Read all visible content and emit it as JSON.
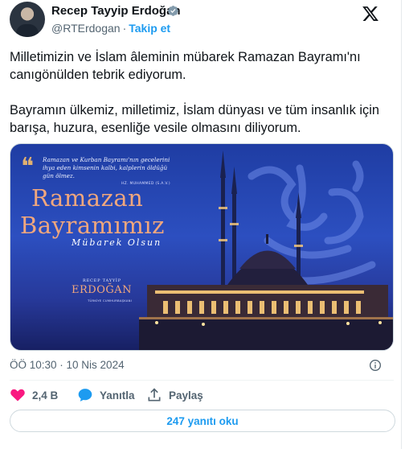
{
  "author": {
    "name": "Recep Tayyip Erdoğan",
    "handle": "@RTErdogan",
    "separator": "·",
    "follow_label": "Takip et"
  },
  "icons": {
    "verified": "verified-badge-icon",
    "x_logo": "x-logo-icon",
    "info": "info-icon",
    "like": "heart-icon",
    "reply": "speech-bubble-icon",
    "share": "share-icon"
  },
  "tweet": {
    "paragraphs": [
      "Milletimizin ve İslam âleminin mübarek Ramazan Bayramı'nı canıgönülden tebrik ediyorum.",
      "Bayramın ülkemiz, milletimiz, İslam dünyası ve tüm insanlık için barışa, huzura, esenliğe vesile olmasını diliyorum."
    ]
  },
  "media": {
    "quote_mark": "❝",
    "hadith": "Ramazan ve Kurban Bayramı'nın gecelerini ihya eden kimsenin kalbi, kalplerin öldüğü gün ölmez.",
    "hadith_source": "HZ. MUHAMMED (S.A.V.)",
    "title_line1": "Ramazan",
    "title_line2": "Bayramımız",
    "subtitle": "Mübarek Olsun",
    "signature_top": "RECEP TAYYİP",
    "signature_name": "ERDOĞAN",
    "signature_sub": "TÜRKİYE CUMHURBAŞKANI",
    "colors": {
      "sky_top": "#1f3da3",
      "sky_bottom": "#172063",
      "accent": "#f1a77d",
      "glow": "#ffcf7a"
    }
  },
  "meta": {
    "timestamp": "ÖÖ 10:30 · 10 Nis 2024"
  },
  "actions": {
    "likes": "2,4 B",
    "reply": "Yanıtla",
    "share": "Paylaş"
  },
  "replies_button": "247 yanıtı oku",
  "colors": {
    "brand": "#1d9bf0",
    "like": "#f91880",
    "muted": "#536471"
  }
}
